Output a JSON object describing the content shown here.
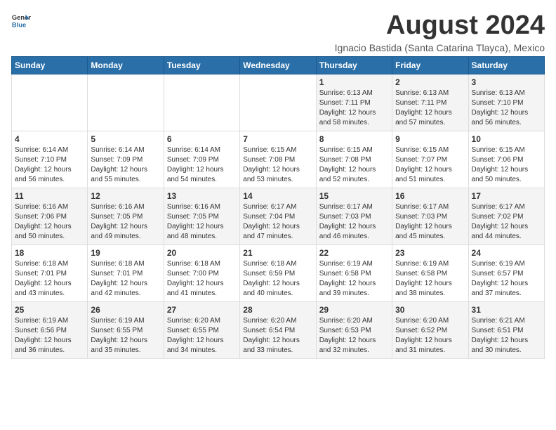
{
  "logo": {
    "general": "General",
    "blue": "Blue"
  },
  "title": "August 2024",
  "location": "Ignacio Bastida (Santa Catarina Tlayca), Mexico",
  "days_of_week": [
    "Sunday",
    "Monday",
    "Tuesday",
    "Wednesday",
    "Thursday",
    "Friday",
    "Saturday"
  ],
  "weeks": [
    [
      {
        "day": "",
        "info": ""
      },
      {
        "day": "",
        "info": ""
      },
      {
        "day": "",
        "info": ""
      },
      {
        "day": "",
        "info": ""
      },
      {
        "day": "1",
        "info": "Sunrise: 6:13 AM\nSunset: 7:11 PM\nDaylight: 12 hours\nand 58 minutes."
      },
      {
        "day": "2",
        "info": "Sunrise: 6:13 AM\nSunset: 7:11 PM\nDaylight: 12 hours\nand 57 minutes."
      },
      {
        "day": "3",
        "info": "Sunrise: 6:13 AM\nSunset: 7:10 PM\nDaylight: 12 hours\nand 56 minutes."
      }
    ],
    [
      {
        "day": "4",
        "info": "Sunrise: 6:14 AM\nSunset: 7:10 PM\nDaylight: 12 hours\nand 56 minutes."
      },
      {
        "day": "5",
        "info": "Sunrise: 6:14 AM\nSunset: 7:09 PM\nDaylight: 12 hours\nand 55 minutes."
      },
      {
        "day": "6",
        "info": "Sunrise: 6:14 AM\nSunset: 7:09 PM\nDaylight: 12 hours\nand 54 minutes."
      },
      {
        "day": "7",
        "info": "Sunrise: 6:15 AM\nSunset: 7:08 PM\nDaylight: 12 hours\nand 53 minutes."
      },
      {
        "day": "8",
        "info": "Sunrise: 6:15 AM\nSunset: 7:08 PM\nDaylight: 12 hours\nand 52 minutes."
      },
      {
        "day": "9",
        "info": "Sunrise: 6:15 AM\nSunset: 7:07 PM\nDaylight: 12 hours\nand 51 minutes."
      },
      {
        "day": "10",
        "info": "Sunrise: 6:15 AM\nSunset: 7:06 PM\nDaylight: 12 hours\nand 50 minutes."
      }
    ],
    [
      {
        "day": "11",
        "info": "Sunrise: 6:16 AM\nSunset: 7:06 PM\nDaylight: 12 hours\nand 50 minutes."
      },
      {
        "day": "12",
        "info": "Sunrise: 6:16 AM\nSunset: 7:05 PM\nDaylight: 12 hours\nand 49 minutes."
      },
      {
        "day": "13",
        "info": "Sunrise: 6:16 AM\nSunset: 7:05 PM\nDaylight: 12 hours\nand 48 minutes."
      },
      {
        "day": "14",
        "info": "Sunrise: 6:17 AM\nSunset: 7:04 PM\nDaylight: 12 hours\nand 47 minutes."
      },
      {
        "day": "15",
        "info": "Sunrise: 6:17 AM\nSunset: 7:03 PM\nDaylight: 12 hours\nand 46 minutes."
      },
      {
        "day": "16",
        "info": "Sunrise: 6:17 AM\nSunset: 7:03 PM\nDaylight: 12 hours\nand 45 minutes."
      },
      {
        "day": "17",
        "info": "Sunrise: 6:17 AM\nSunset: 7:02 PM\nDaylight: 12 hours\nand 44 minutes."
      }
    ],
    [
      {
        "day": "18",
        "info": "Sunrise: 6:18 AM\nSunset: 7:01 PM\nDaylight: 12 hours\nand 43 minutes."
      },
      {
        "day": "19",
        "info": "Sunrise: 6:18 AM\nSunset: 7:01 PM\nDaylight: 12 hours\nand 42 minutes."
      },
      {
        "day": "20",
        "info": "Sunrise: 6:18 AM\nSunset: 7:00 PM\nDaylight: 12 hours\nand 41 minutes."
      },
      {
        "day": "21",
        "info": "Sunrise: 6:18 AM\nSunset: 6:59 PM\nDaylight: 12 hours\nand 40 minutes."
      },
      {
        "day": "22",
        "info": "Sunrise: 6:19 AM\nSunset: 6:58 PM\nDaylight: 12 hours\nand 39 minutes."
      },
      {
        "day": "23",
        "info": "Sunrise: 6:19 AM\nSunset: 6:58 PM\nDaylight: 12 hours\nand 38 minutes."
      },
      {
        "day": "24",
        "info": "Sunrise: 6:19 AM\nSunset: 6:57 PM\nDaylight: 12 hours\nand 37 minutes."
      }
    ],
    [
      {
        "day": "25",
        "info": "Sunrise: 6:19 AM\nSunset: 6:56 PM\nDaylight: 12 hours\nand 36 minutes."
      },
      {
        "day": "26",
        "info": "Sunrise: 6:19 AM\nSunset: 6:55 PM\nDaylight: 12 hours\nand 35 minutes."
      },
      {
        "day": "27",
        "info": "Sunrise: 6:20 AM\nSunset: 6:55 PM\nDaylight: 12 hours\nand 34 minutes."
      },
      {
        "day": "28",
        "info": "Sunrise: 6:20 AM\nSunset: 6:54 PM\nDaylight: 12 hours\nand 33 minutes."
      },
      {
        "day": "29",
        "info": "Sunrise: 6:20 AM\nSunset: 6:53 PM\nDaylight: 12 hours\nand 32 minutes."
      },
      {
        "day": "30",
        "info": "Sunrise: 6:20 AM\nSunset: 6:52 PM\nDaylight: 12 hours\nand 31 minutes."
      },
      {
        "day": "31",
        "info": "Sunrise: 6:21 AM\nSunset: 6:51 PM\nDaylight: 12 hours\nand 30 minutes."
      }
    ]
  ]
}
